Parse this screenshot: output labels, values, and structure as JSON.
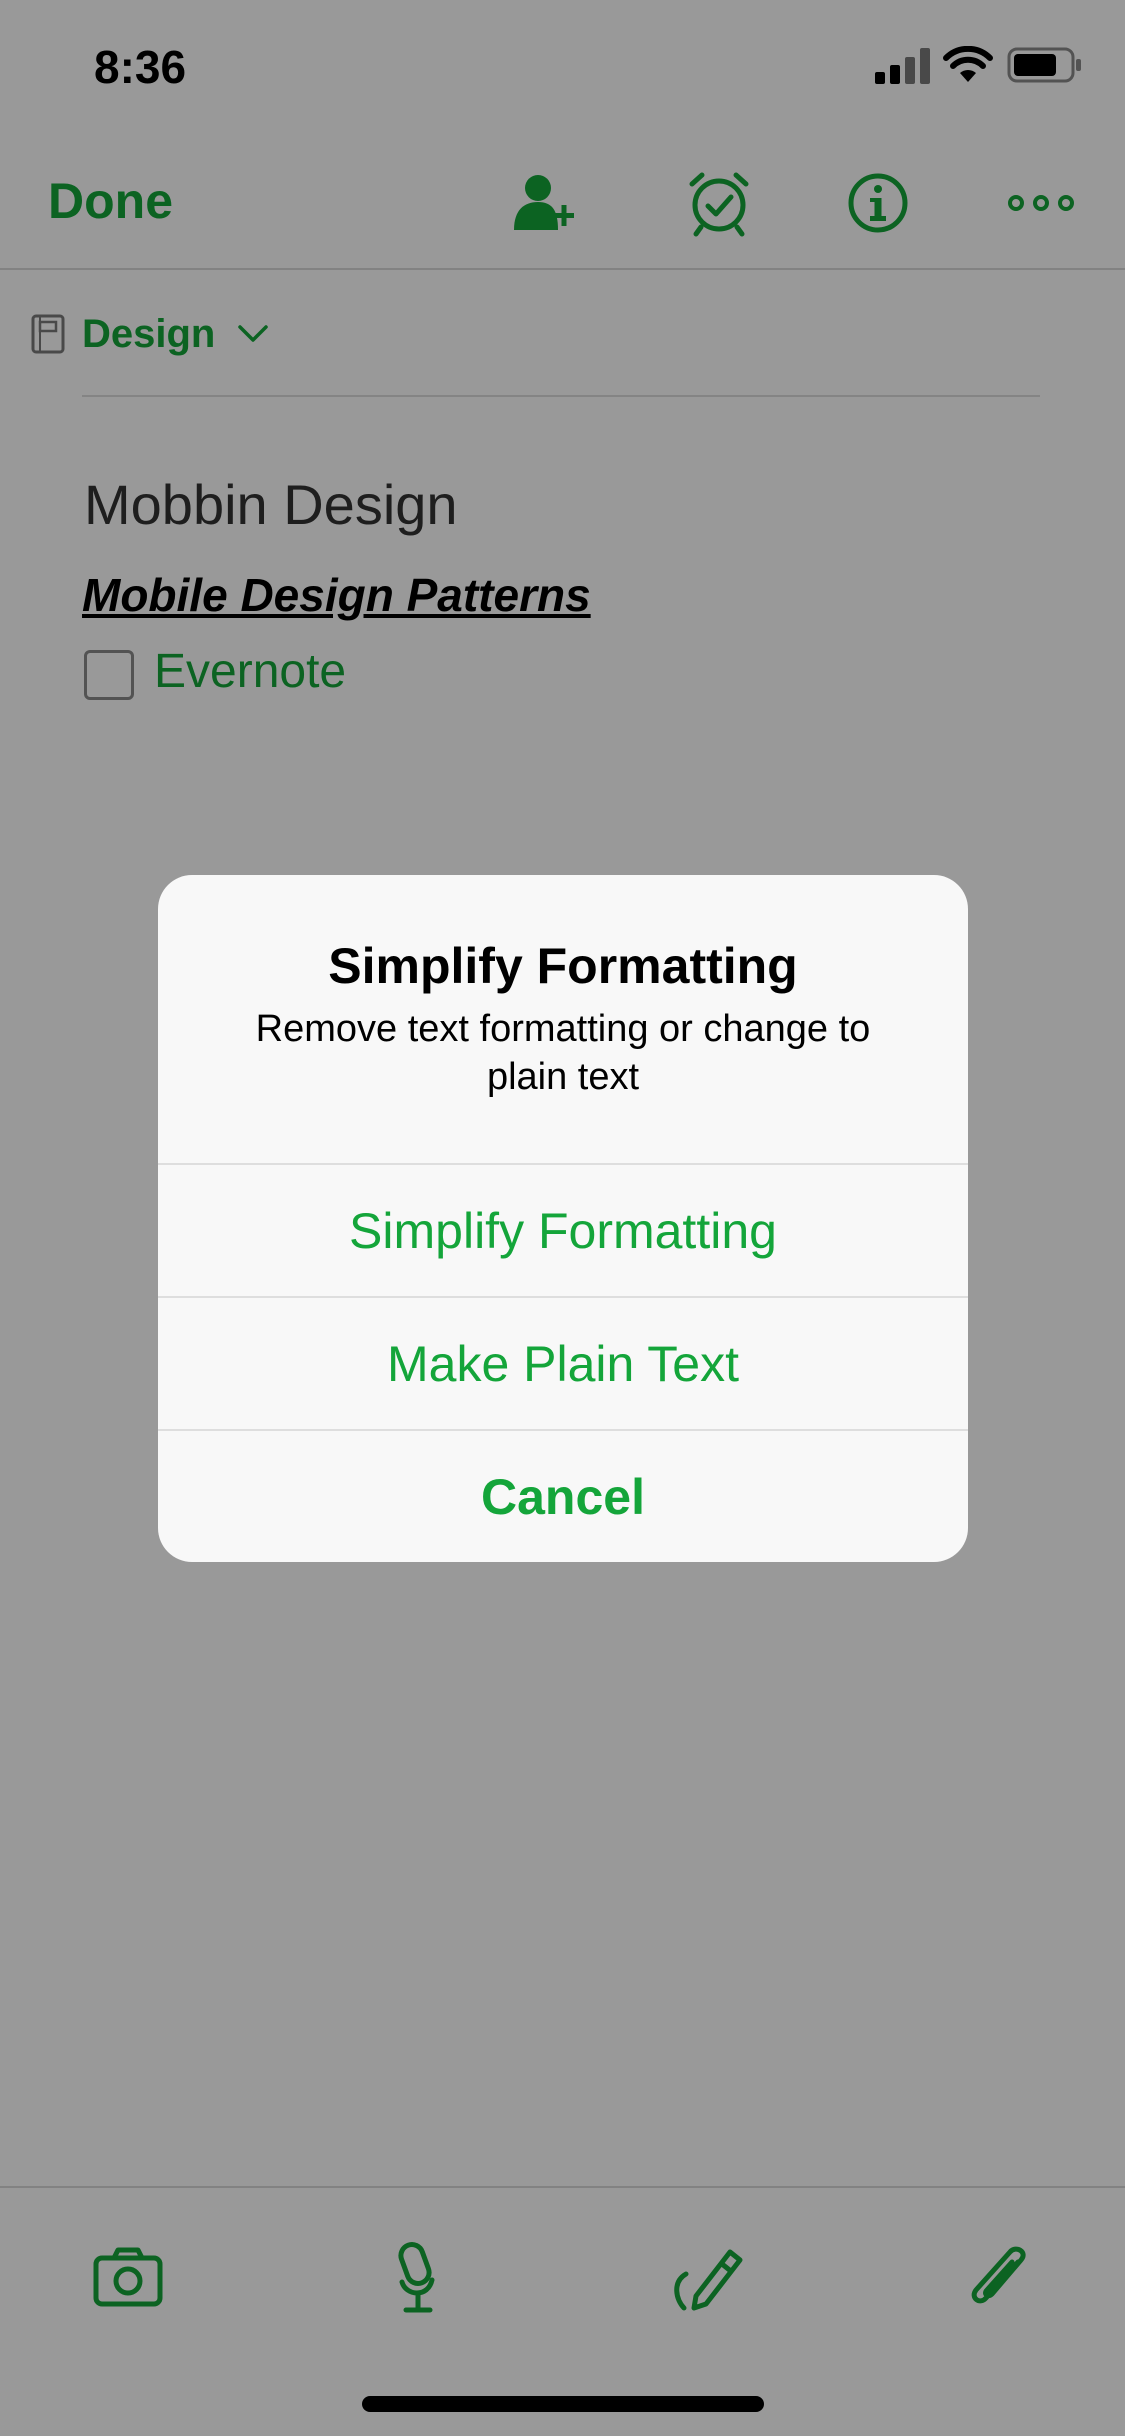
{
  "status_bar": {
    "time": "8:36"
  },
  "nav": {
    "done_label": "Done"
  },
  "notebook": {
    "name": "Design"
  },
  "note": {
    "title": "Mobbin Design",
    "subtitle": "Mobile Design Patterns",
    "checklist": [
      {
        "label": "Evernote",
        "checked": false
      }
    ]
  },
  "alert": {
    "title": "Simplify Formatting",
    "message": "Remove text formatting or change to plain text",
    "buttons": {
      "simplify": "Simplify Formatting",
      "plain": "Make Plain Text",
      "cancel": "Cancel"
    }
  },
  "colors": {
    "accent": "#14a53a",
    "overlay": "rgba(0,0,0,0.40)",
    "alert_bg": "#f8f8f8"
  }
}
